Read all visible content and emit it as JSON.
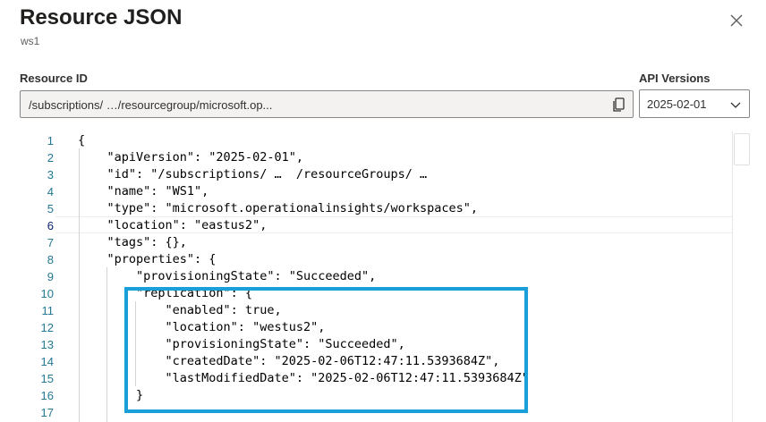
{
  "header": {
    "title": "Resource JSON",
    "subtitle": "ws1"
  },
  "resource_id": {
    "label": "Resource ID",
    "value": "/subscriptions/ …/resourcegroup/microsoft.op..."
  },
  "api_versions": {
    "label": "API Versions",
    "selected": "2025-02-01"
  },
  "editor": {
    "line_numbers": [
      "1",
      "2",
      "3",
      "4",
      "5",
      "6",
      "7",
      "8",
      "9",
      "10",
      "11",
      "12",
      "13",
      "14",
      "15",
      "16",
      "17"
    ],
    "lines": [
      "{",
      "    \"apiVersion\": \"2025-02-01\",",
      "    \"id\": \"/subscriptions/ …  /resourceGroups/ …",
      "    \"name\": \"WS1\",",
      "    \"type\": \"microsoft.operationalinsights/workspaces\",",
      "    \"location\": \"eastus2\",",
      "    \"tags\": {},",
      "    \"properties\": {",
      "        \"provisioningState\": \"Succeeded\",",
      "        \"replication\": {",
      "            \"enabled\": true,",
      "            \"location\": \"westus2\",",
      "            \"provisioningState\": \"Succeeded\",",
      "            \"createdDate\": \"2025-02-06T12:47:11.5393684Z\",",
      "            \"lastModifiedDate\": \"2025-02-06T12:47:11.5393684Z\"",
      "        }",
      ""
    ],
    "active_line": "6"
  },
  "colors": {
    "line_number": "#237893",
    "highlight_border": "#1a9fd9"
  }
}
